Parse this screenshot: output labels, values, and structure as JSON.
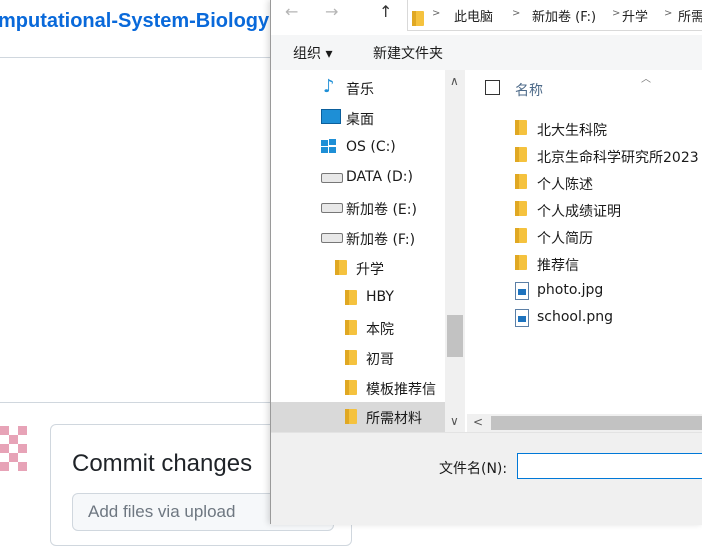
{
  "github": {
    "repo_title": "mputational-System-Biology",
    "slash": "/",
    "commit_title": "Commit changes",
    "commit_placeholder": "Add files via upload"
  },
  "dialog": {
    "nav_back": "←",
    "nav_forward": "→",
    "nav_up": "↑",
    "breadcrumb": [
      "此电脑",
      "新加卷 (F:)",
      "升学",
      "所需"
    ],
    "toolbar": {
      "organize": "组织 ▾",
      "new_folder": "新建文件夹"
    },
    "nav_items": [
      {
        "label": "音乐",
        "icon": "music-icon"
      },
      {
        "label": "桌面",
        "icon": "desktop-icon"
      },
      {
        "label": "OS (C:)",
        "icon": "windows-drive-icon"
      },
      {
        "label": "DATA (D:)",
        "icon": "drive-icon"
      },
      {
        "label": "新加卷 (E:)",
        "icon": "drive-icon"
      },
      {
        "label": "新加卷 (F:)",
        "icon": "drive-icon"
      },
      {
        "label": "升学",
        "icon": "folder-icon"
      },
      {
        "label": "HBY",
        "icon": "folder-icon"
      },
      {
        "label": "本院",
        "icon": "folder-icon"
      },
      {
        "label": "初哥",
        "icon": "folder-icon"
      },
      {
        "label": "模板推荐信",
        "icon": "folder-icon"
      },
      {
        "label": "所需材料",
        "icon": "folder-icon",
        "selected": true
      }
    ],
    "column_header": "名称",
    "files": [
      {
        "name": "北大生科院",
        "icon": "folder-icon"
      },
      {
        "name": "北京生命科学研究所2023",
        "icon": "folder-icon"
      },
      {
        "name": "个人陈述",
        "icon": "folder-icon"
      },
      {
        "name": "个人成绩证明",
        "icon": "folder-icon"
      },
      {
        "name": "个人简历",
        "icon": "folder-icon"
      },
      {
        "name": "推荐信",
        "icon": "folder-icon"
      },
      {
        "name": "photo.jpg",
        "icon": "image-file-icon"
      },
      {
        "name": "school.png",
        "icon": "image-file-icon"
      }
    ],
    "filename_label": "文件名(N):",
    "filename_value": ""
  }
}
